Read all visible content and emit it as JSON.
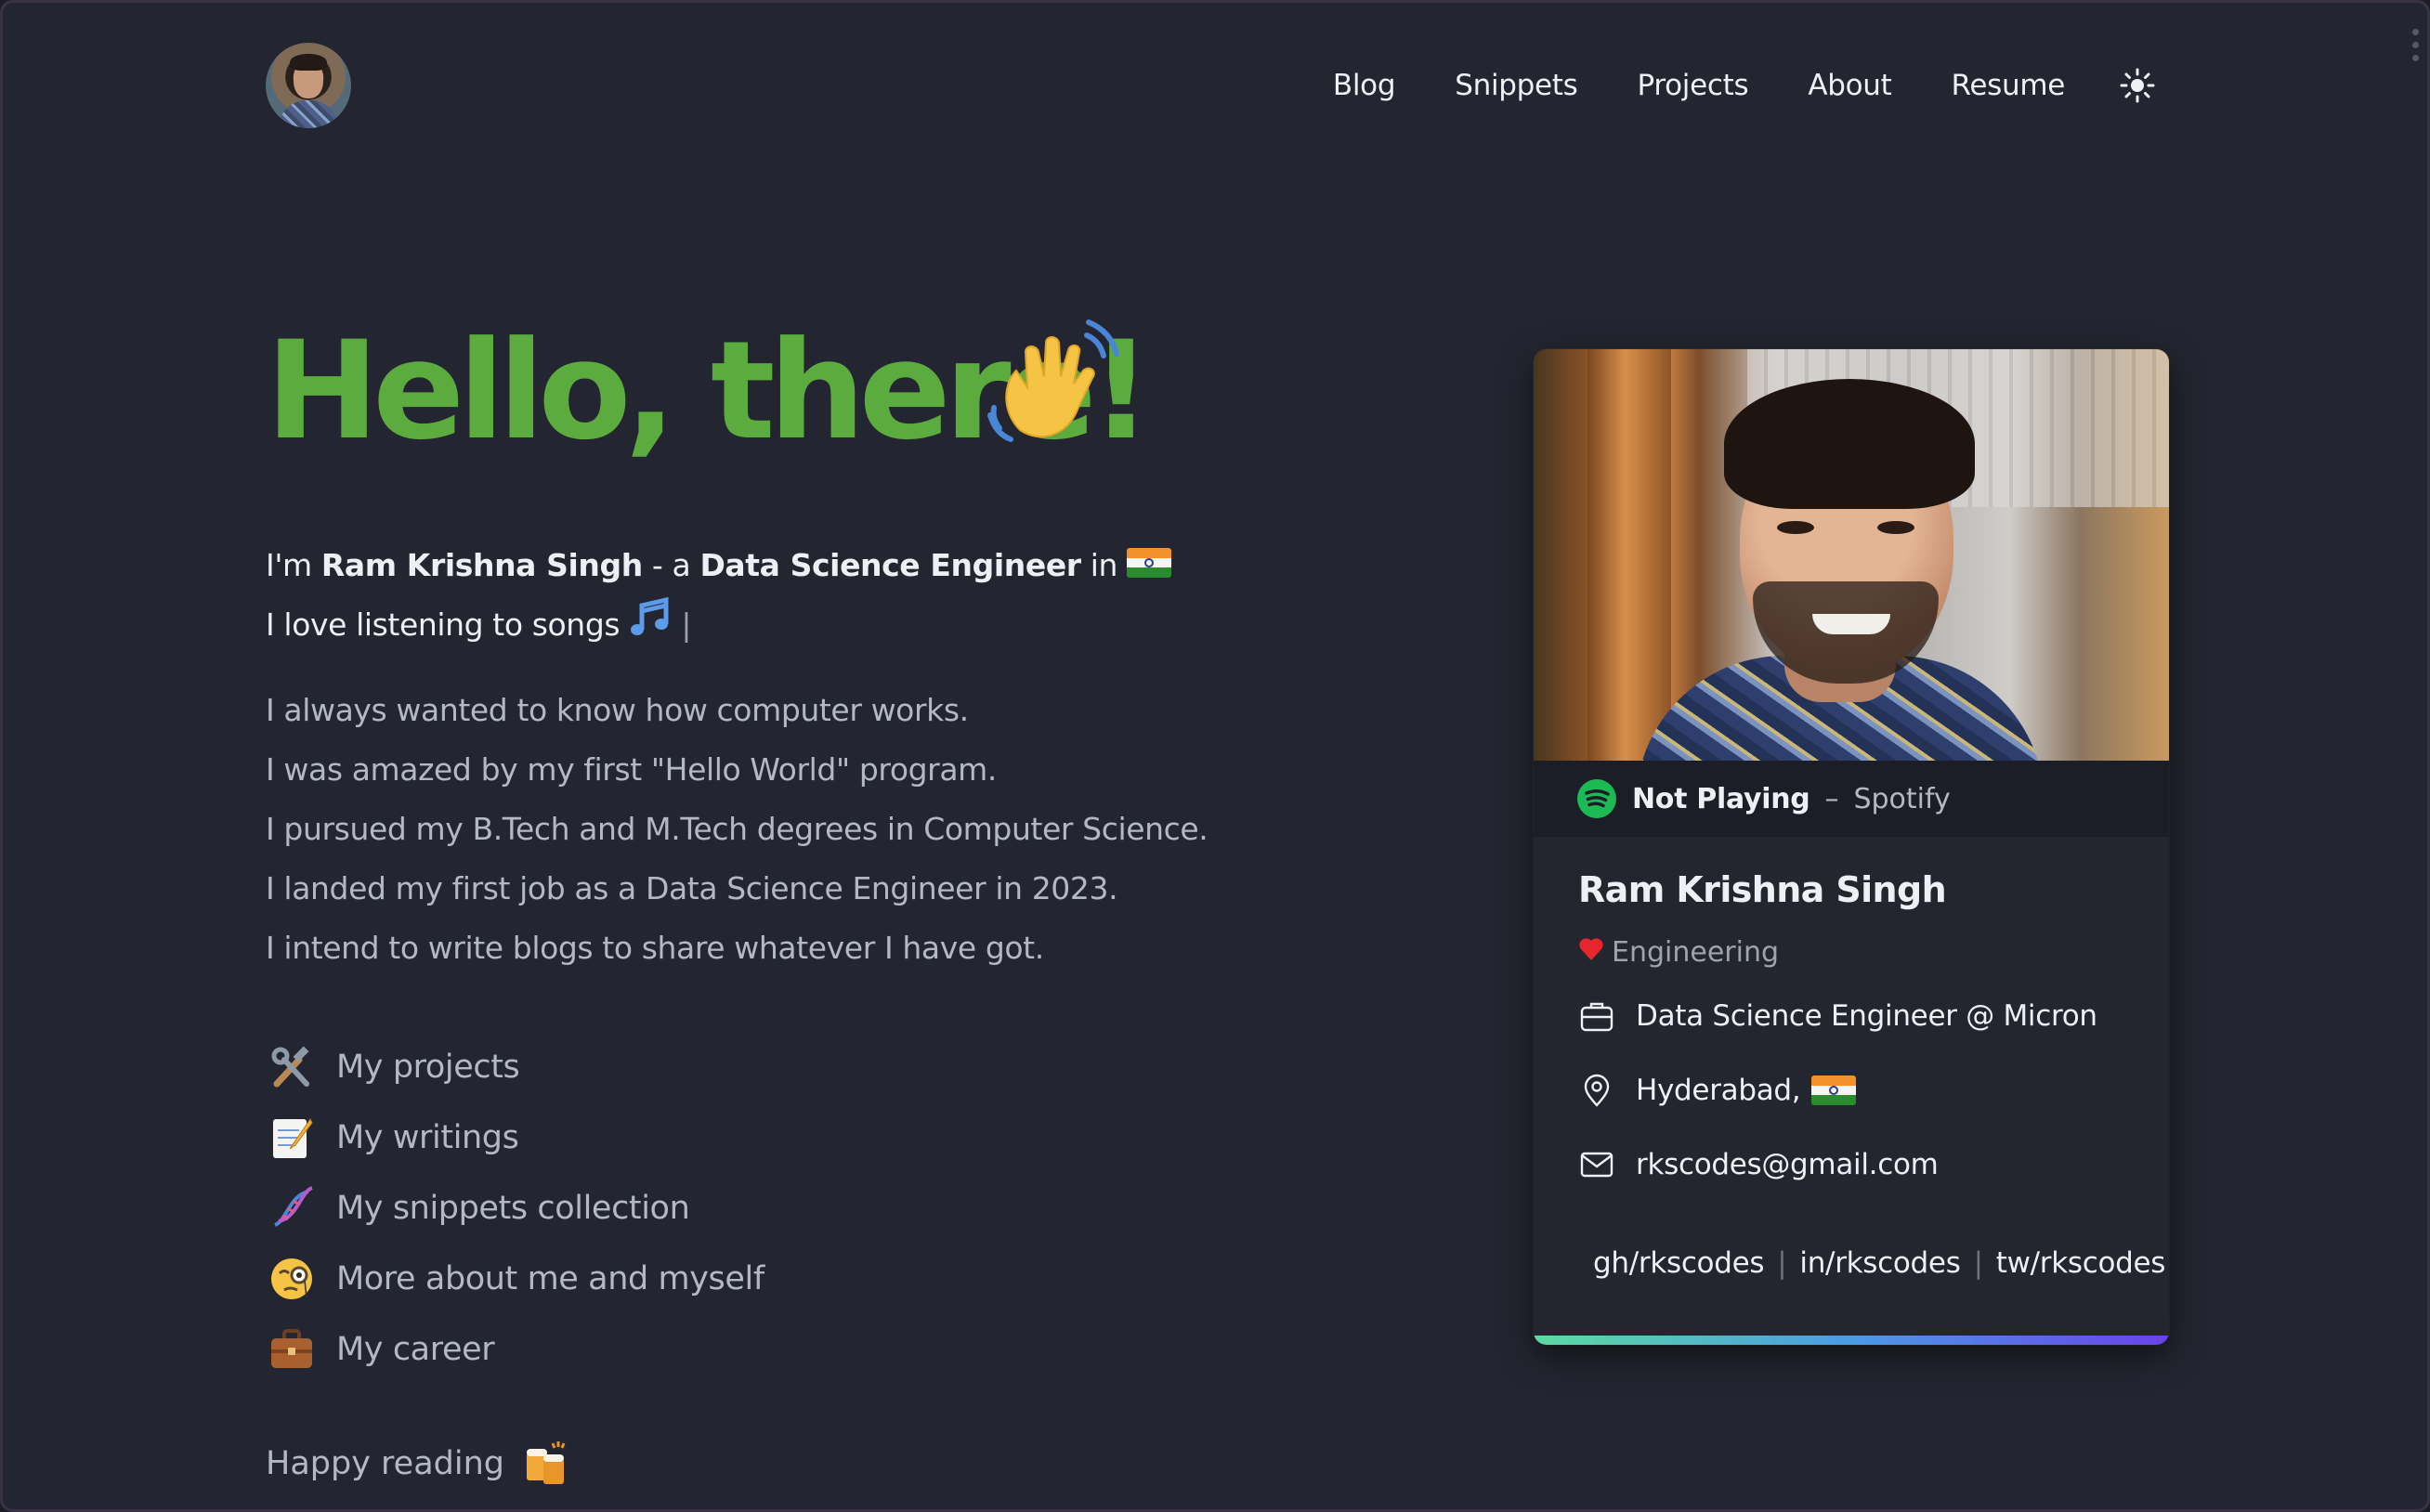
{
  "header": {
    "avatar_alt": "profile avatar",
    "nav": [
      {
        "label": "Blog"
      },
      {
        "label": "Snippets"
      },
      {
        "label": "Projects"
      },
      {
        "label": "About"
      },
      {
        "label": "Resume"
      }
    ],
    "theme_icon": "sun-icon"
  },
  "hero": {
    "title": "Hello, there!",
    "title_color": "#5cab3f",
    "intro_prefix": "I'm ",
    "intro_name": "Ram Krishna Singh",
    "intro_mid": " - a ",
    "intro_role": "Data Science Engineer",
    "intro_suffix": " in ",
    "line2": "I love listening to songs ",
    "caret": "|",
    "story": [
      "I always wanted to know how computer works.",
      "I was amazed by my first \"Hello World\" program.",
      "I pursued my B.Tech and M.Tech degrees in Computer Science.",
      "I landed my first job as a Data Science Engineer in 2023.",
      "I intend to write blogs to share whatever I have got."
    ],
    "links": [
      {
        "icon": "hammer-wrench-icon",
        "label": "My projects"
      },
      {
        "icon": "memo-icon",
        "label": "My writings"
      },
      {
        "icon": "dna-icon",
        "label": "My snippets collection"
      },
      {
        "icon": "monocle-face-icon",
        "label": "More about me and myself"
      },
      {
        "icon": "briefcase-icon",
        "label": "My career"
      }
    ],
    "closing": "Happy reading"
  },
  "card": {
    "spotify_status": "Not Playing",
    "spotify_sep": "–",
    "spotify_label": "Spotify",
    "name": "Ram Krishna Singh",
    "tagline": "Engineering",
    "job": "Data Science Engineer @ Micron",
    "location": "Hyderabad,",
    "email": "rkscodes@gmail.com",
    "socials": [
      "gh/rkscodes",
      "in/rkscodes",
      "tw/rkscodes"
    ],
    "accent_colors": [
      "#5ddba0",
      "#4a9be6",
      "#6a42e8"
    ]
  }
}
